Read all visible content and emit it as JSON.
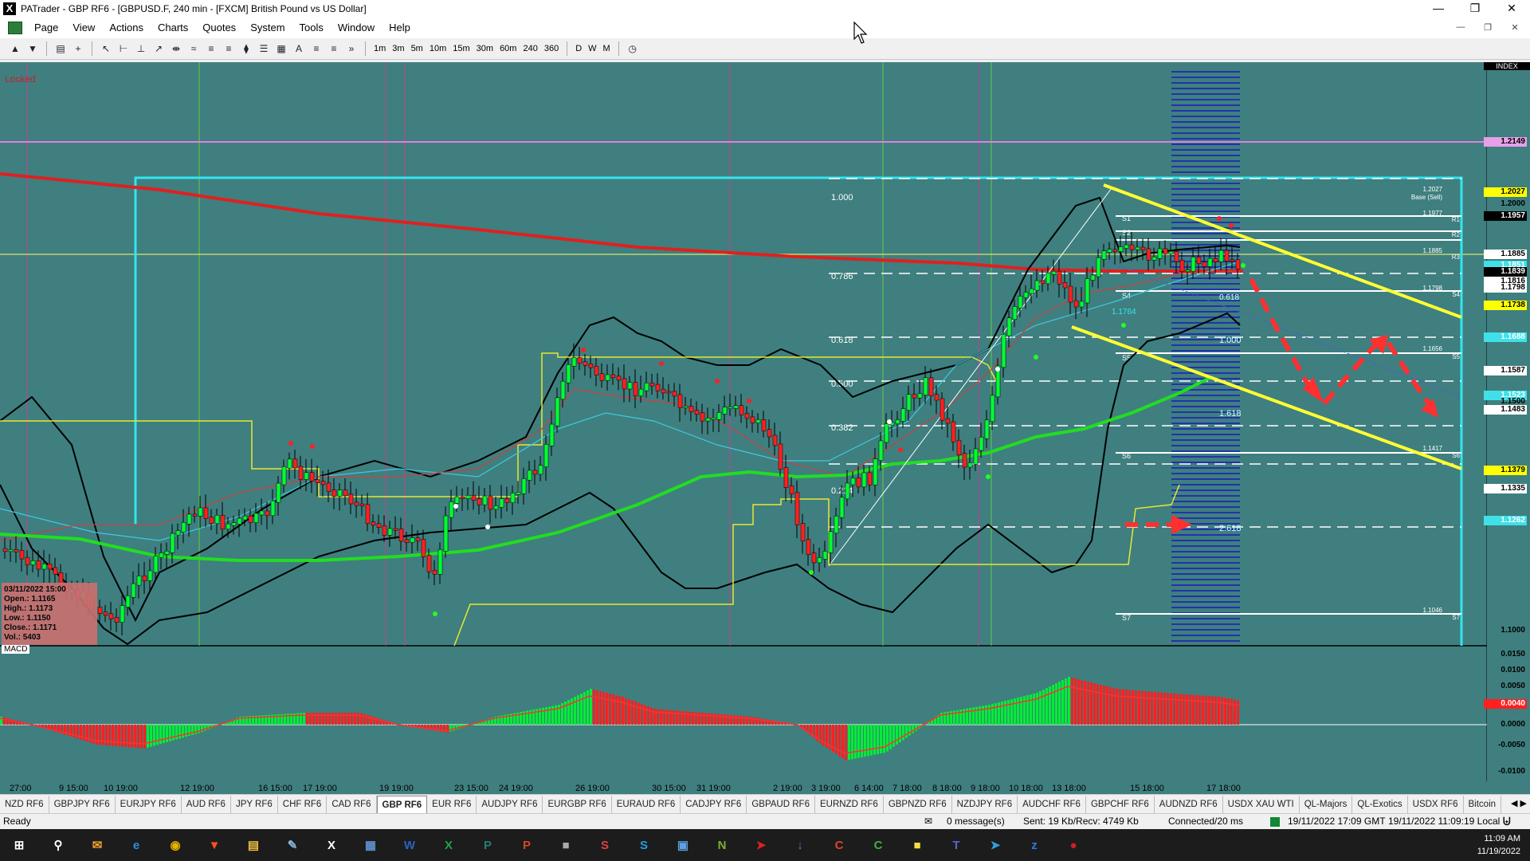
{
  "app": {
    "title": "PATrader - GBP RF6 - [GBPUSD.F, 240 min - [FXCM] British Pound vs US Dollar]",
    "icon": "x-logo-icon"
  },
  "menu": [
    "Page",
    "View",
    "Actions",
    "Charts",
    "Quotes",
    "System",
    "Tools",
    "Window",
    "Help"
  ],
  "toolbar": {
    "timeframes": [
      "1m",
      "3m",
      "5m",
      "10m",
      "15m",
      "30m",
      "60m",
      "240",
      "360",
      "D",
      "W",
      "M"
    ]
  },
  "chart": {
    "locked_label": "Locked",
    "index_label": "INDEX",
    "macd_label": "MACD",
    "fib_levels": [
      "1.000",
      "0.786",
      "0.618",
      "0.500",
      "0.382",
      "0.214"
    ],
    "ext_levels": [
      "1.000",
      "1.618",
      "2.618"
    ],
    "fib_small": [
      "0.618"
    ],
    "pivot_labels": [
      "S1",
      "S2",
      "S4",
      "S5",
      "S6",
      "S7"
    ],
    "box_value": "1.1764",
    "right_labels": [
      "1.2027",
      "Base (Sell)",
      "1.1977",
      "1.1885",
      "1.1798",
      "1.1656",
      "1.1417",
      "1.1046",
      "R1",
      "R2",
      "R3",
      "S4",
      "S5",
      "S6",
      "S7"
    ],
    "price_axis": [
      {
        "v": "1.2149",
        "bg": "#e6a0e6",
        "fg": "#000"
      },
      {
        "v": "1.2027",
        "bg": "#ffff00",
        "fg": "#000"
      },
      {
        "v": "1.2000",
        "bg": "",
        "fg": "#000"
      },
      {
        "v": "1.1957",
        "bg": "#000000",
        "fg": "#fff"
      },
      {
        "v": "1.1885",
        "bg": "#ffffff",
        "fg": "#000"
      },
      {
        "v": "1.1851",
        "bg": "#40e0e8",
        "fg": "#fff"
      },
      {
        "v": "1.1839",
        "bg": "#000000",
        "fg": "#fff"
      },
      {
        "v": "1.1816",
        "bg": "#ffffff",
        "fg": "#000"
      },
      {
        "v": "1.1798",
        "bg": "#ffffff",
        "fg": "#000"
      },
      {
        "v": "1.1738",
        "bg": "#ffff00",
        "fg": "#000"
      },
      {
        "v": "1.1688",
        "bg": "#40e0e8",
        "fg": "#fff"
      },
      {
        "v": "1.1587",
        "bg": "#ffffff",
        "fg": "#000"
      },
      {
        "v": "1.1523",
        "bg": "#40e0e8",
        "fg": "#fff"
      },
      {
        "v": "1.1500",
        "bg": "",
        "fg": "#000"
      },
      {
        "v": "1.1483",
        "bg": "#ffffff",
        "fg": "#000"
      },
      {
        "v": "1.1379",
        "bg": "#ffff00",
        "fg": "#000"
      },
      {
        "v": "1.1335",
        "bg": "#ffffff",
        "fg": "#000"
      },
      {
        "v": "1.1262",
        "bg": "#40e0e8",
        "fg": "#fff"
      },
      {
        "v": "1.1000",
        "bg": "",
        "fg": "#000"
      }
    ],
    "macd_axis": [
      "0.0150",
      "0.0100",
      "0.0050",
      "0.0040",
      "0.0000",
      "-0.0050",
      "-0.0100"
    ],
    "x_labels": [
      "27:00",
      "9 15:00",
      "10 19:00",
      "12 19:00",
      "16 15:00",
      "17 19:00",
      "19 19:00",
      "23 15:00",
      "24 19:00",
      "26 19:00",
      "30 15:00",
      "31 19:00",
      "2 19:00",
      "3 19:00",
      "6 14:00",
      "7 18:00",
      "8 18:00",
      "9 18:00",
      "10 18:00",
      "13 18:00",
      "15 18:00",
      "17 18:00"
    ]
  },
  "infobox": {
    "date": "03/11/2022 15:00",
    "open": "Open.: 1.1165",
    "high": "High.: 1.1173",
    "low": "Low.: 1.1150",
    "close": "Close.: 1.1171",
    "vol": "Vol.: 5403"
  },
  "tabs": [
    "NZD RF6",
    "GBPJPY RF6",
    "EURJPY RF6",
    "AUD RF6",
    "JPY RF6",
    "CHF RF6",
    "CAD RF6",
    "GBP RF6",
    "EUR RF6",
    "AUDJPY RF6",
    "EURGBP RF6",
    "EURAUD RF6",
    "CADJPY RF6",
    "GBPAUD RF6",
    "EURNZD RF6",
    "GBPNZD RF6",
    "NZDJPY RF6",
    "AUDCHF RF6",
    "GBPCHF RF6",
    "AUDNZD RF6",
    "USDX XAU WTI",
    "QL-Majors",
    "QL-Exotics",
    "USDX RF6",
    "Bitcoin"
  ],
  "active_tab": "GBP RF6",
  "status": {
    "ready": "Ready",
    "messages": "0 message(s)",
    "traffic": "Sent: 19 Kb/Recv: 4749 Kb",
    "connected": "Connected/20 ms",
    "server_time": "19/11/2022 17:09 GMT",
    "local_time": "19/11/2022 11:09:19 Local"
  },
  "taskbar": {
    "time": "11:09 AM",
    "date": "11/19/2022",
    "icons": [
      "windows-start-icon",
      "search-icon",
      "mail-app-icon",
      "edge-icon",
      "chrome-icon",
      "brave-icon",
      "file-explorer-icon",
      "notepad-icon",
      "patrader-icon",
      "calculator-icon",
      "word-icon",
      "excel-icon",
      "publisher-icon",
      "powerpoint-icon",
      "media-icon",
      "snagit-icon",
      "skype-icon",
      "screen-icon",
      "ninjatrader-icon",
      "red-bird-icon",
      "download-icon",
      "camtasia-icon",
      "camtasia-green-icon",
      "sticky-notes-icon",
      "teams-icon",
      "telegram-icon",
      "zoom-icon",
      "record-icon"
    ]
  },
  "colors": {
    "chart_bg": "#3f7f7f",
    "bull": "#00ff33",
    "bear": "#ff2020",
    "channel": "#ffff33",
    "cyan_box": "#33e6f0",
    "ma_red": "#e02020",
    "ma_green": "#22dd22",
    "magenta_line": "#e080e0"
  }
}
